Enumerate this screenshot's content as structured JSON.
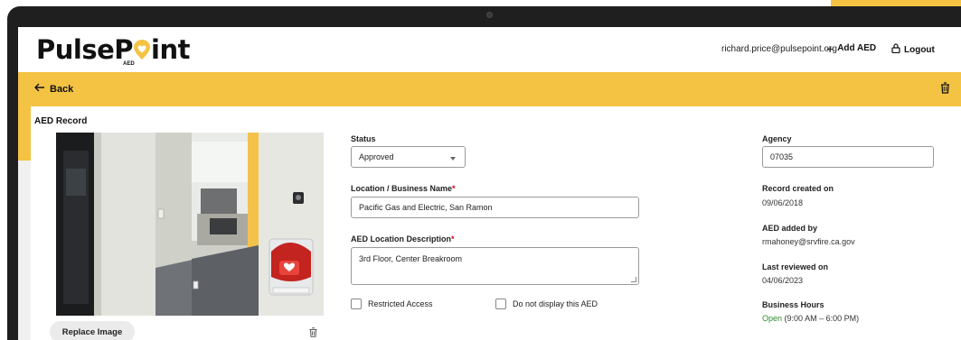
{
  "header": {
    "logo_text_start": "PulseP",
    "logo_text_end": "int",
    "logo_subtext": "AED",
    "user_email": "richard.price@pulsepoint.org",
    "add_aed_label": "Add AED",
    "logout_label": "Logout"
  },
  "nav": {
    "back_label": "Back"
  },
  "record": {
    "section_title": "AED Record",
    "replace_image_label": "Replace Image",
    "status": {
      "label": "Status",
      "value": "Approved"
    },
    "location_name": {
      "label": "Location / Business Name",
      "required_mark": "*",
      "value": "Pacific Gas and Electric, San Ramon"
    },
    "location_description": {
      "label": "AED Location Description",
      "required_mark": "*",
      "value": "3rd Floor, Center Breakroom"
    },
    "restricted_access_label": "Restricted Access",
    "do_not_display_label": "Do not display this AED",
    "agency": {
      "label": "Agency",
      "value": "07035"
    },
    "record_created": {
      "label": "Record created on",
      "value": "09/06/2018"
    },
    "aed_added_by": {
      "label": "AED added by",
      "value": "rmahoney@srvfire.ca.gov"
    },
    "last_reviewed": {
      "label": "Last reviewed on",
      "value": "04/06/2023"
    },
    "business_hours": {
      "label": "Business Hours",
      "status": "Open",
      "hours": "(9:00 AM – 6:00 PM)"
    }
  },
  "colors": {
    "brand_yellow": "#f5c343",
    "required_red": "#d0021b",
    "open_green": "#2e8b2e"
  }
}
